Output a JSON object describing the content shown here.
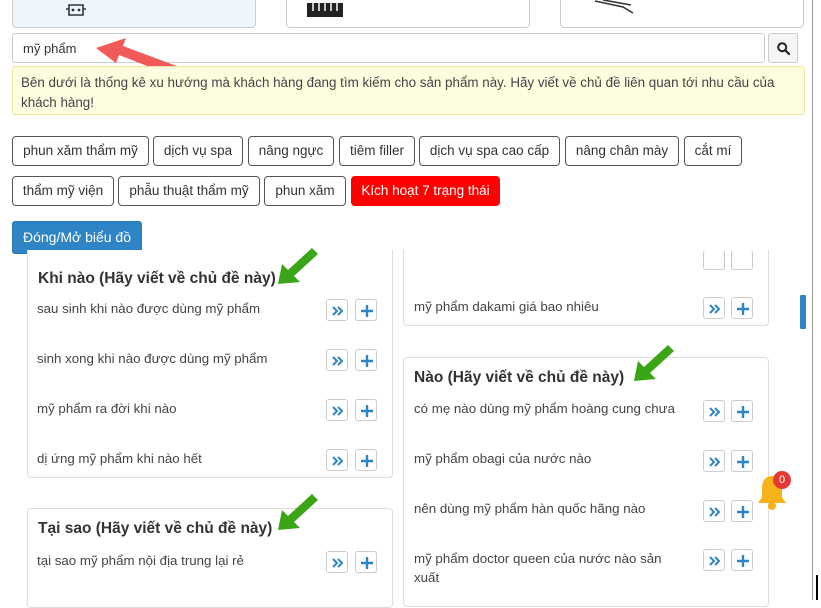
{
  "search": {
    "value": "mỹ phẩm",
    "button_icon": "search-icon"
  },
  "notice": "Bên dưới là thống kê xu hướng mà khách hàng đang tìm kiếm cho sản phẩm này. Hãy viết về chủ đề liên quan tới nhu cầu của khách hàng!",
  "tags": [
    "phun xăm thẩm mỹ",
    "dịch vụ spa",
    "nâng ngực",
    "tiêm filler",
    "dịch vụ spa cao cấp",
    "nâng chân mày",
    "cắt mí",
    "thẩm mỹ viện",
    "phẫu thuật thẩm mỹ",
    "phun xăm"
  ],
  "activate_button": "Kích hoạt 7 trạng thái",
  "toggle_chart_button": "Đóng/Mở biểu đồ",
  "panels": {
    "when": {
      "title": "Khi nào (Hãy viết về chủ đề này)",
      "items": [
        "sau sinh khi nào được dùng mỹ phẩm",
        "sinh xong khi nào được dùng mỹ phẩm",
        "mỹ phẩm ra đời khi nào",
        "dị ứng mỹ phẩm khi nào hết"
      ]
    },
    "why": {
      "title": "Tại sao (Hãy viết về chủ đề này)",
      "items": [
        "tại sao mỹ phẩm nội địa trung lại rẻ"
      ]
    },
    "prev": {
      "items": [
        "mỹ phẩm dakami giá bao nhiêu"
      ]
    },
    "which": {
      "title": "Nào (Hãy viết về chủ đề này)",
      "items": [
        "có mẹ nào dùng mỹ phẩm hoàng cung chưa",
        "mỹ phẩm obagi của nước nào",
        "nên dùng mỹ phẩm hàn quốc hãng nào",
        "mỹ phẩm doctor queen của nước nào sản xuất"
      ]
    }
  },
  "notification_count": "0",
  "colors": {
    "accent": "#2f84c6",
    "active_tag": "#ff0000",
    "arrow_green": "#3aa617",
    "arrow_red": "#f25a5a",
    "notice_bg": "#fffde0"
  }
}
